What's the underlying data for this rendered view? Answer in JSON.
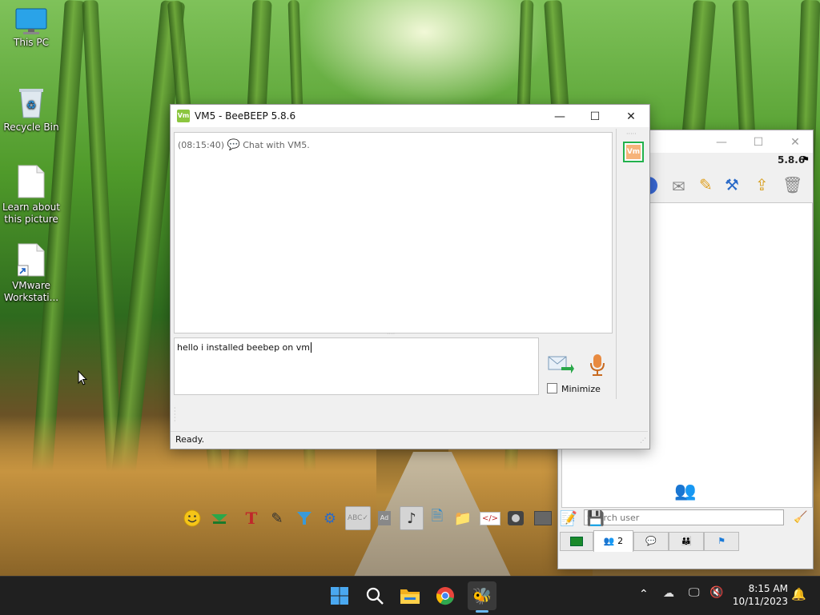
{
  "desktop": {
    "icons": [
      {
        "label": "This PC",
        "icon": "monitor-icon"
      },
      {
        "label": "Recycle Bin",
        "icon": "recycle-bin-icon"
      },
      {
        "label": "Learn about this picture",
        "icon": "document-icon"
      },
      {
        "label": "VMware Workstati...",
        "icon": "shortcut-document-icon"
      }
    ]
  },
  "chat_window": {
    "title": "VM5 - BeeBEEP 5.8.6",
    "message": {
      "time": "(08:15:40)",
      "text": "Chat with VM5."
    },
    "input_value": "hello i installed beebep on vm",
    "minimize_label": "Minimize",
    "minimize_checked": false,
    "status": "Ready.",
    "avatar_text": "Vm",
    "colors": {
      "avatar_border": "#22b14c",
      "avatar_fill": "#f6b37a"
    }
  },
  "main_window": {
    "version": "5.8.6",
    "search_placeholder": "Search user",
    "tabs": [
      {
        "name": "console-tab",
        "label": ""
      },
      {
        "name": "users-tab",
        "label": "2"
      },
      {
        "name": "chats-tab",
        "label": ""
      },
      {
        "name": "groups-tab",
        "label": ""
      },
      {
        "name": "plugins-tab",
        "label": ""
      }
    ]
  },
  "taskbar": {
    "time": "8:15 AM",
    "date": "10/11/2023"
  }
}
